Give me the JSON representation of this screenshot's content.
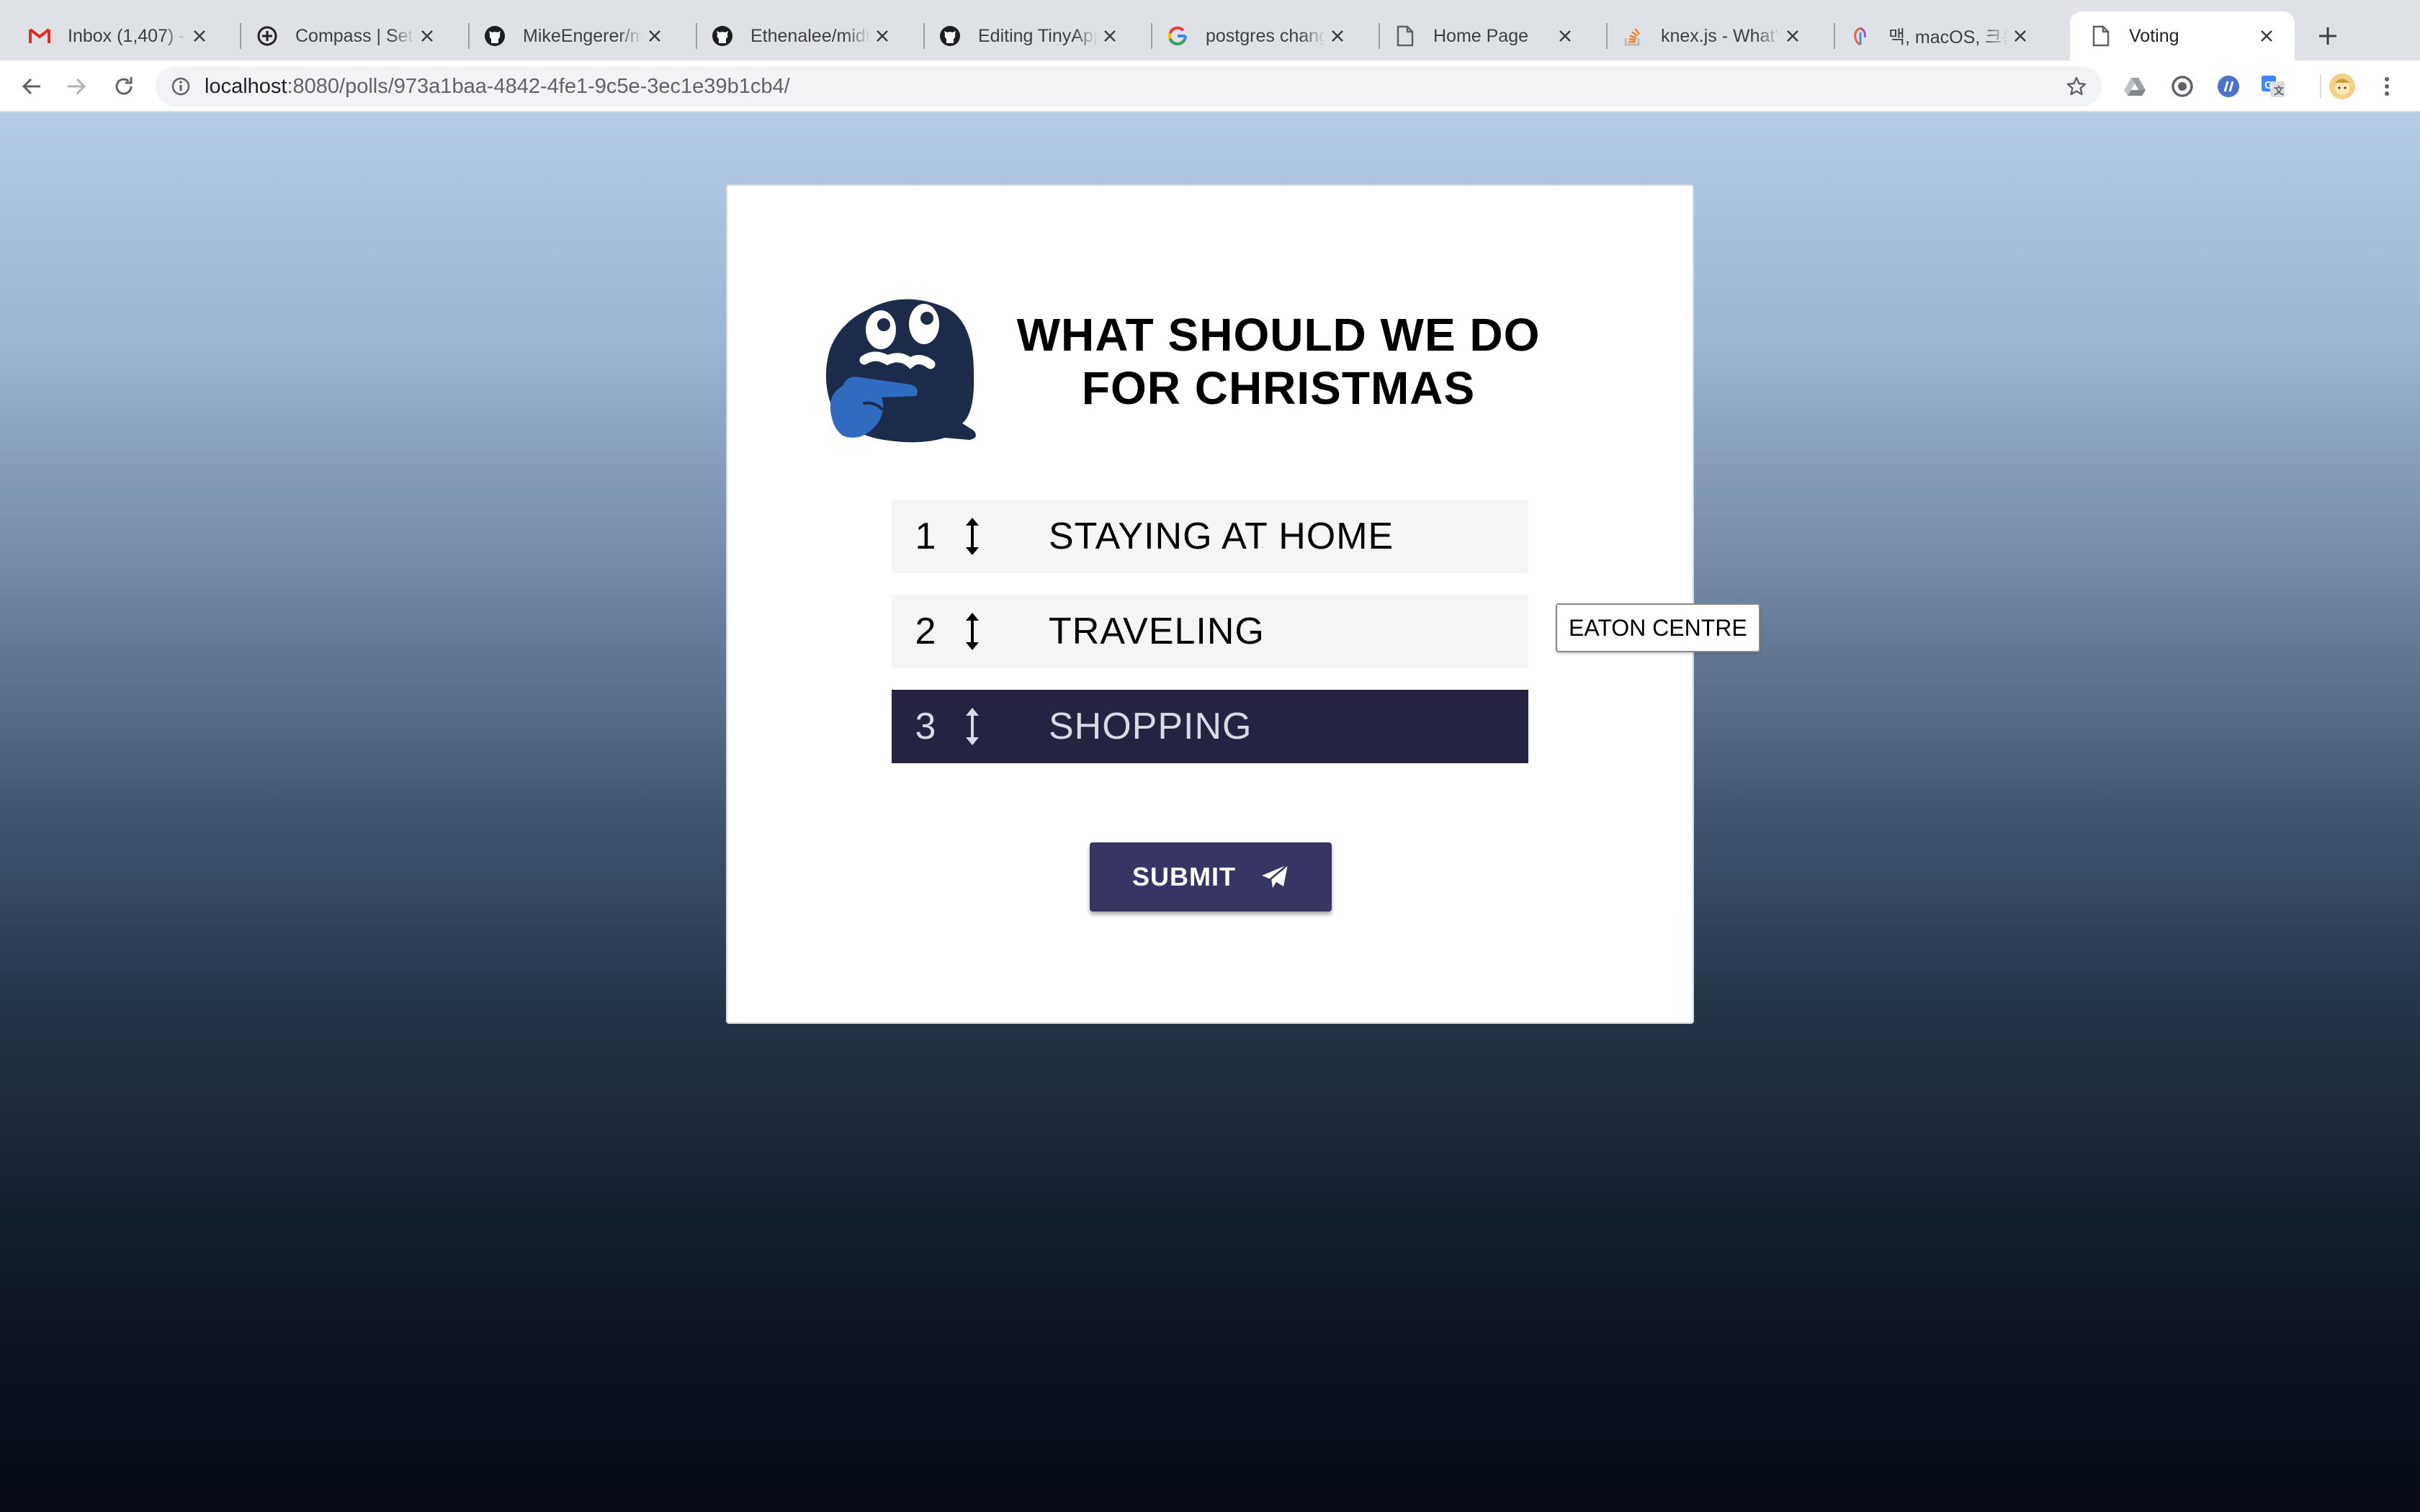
{
  "browser": {
    "tabs": [
      {
        "title": "Inbox (1,407) - y",
        "icon": "gmail-icon",
        "active": false
      },
      {
        "title": "Compass | Setup",
        "icon": "compass-icon",
        "active": false
      },
      {
        "title": "MikeEngerer/mid",
        "icon": "github-icon",
        "active": false
      },
      {
        "title": "Ethenalee/midter",
        "icon": "github-icon",
        "active": false
      },
      {
        "title": "Editing TinyApp/",
        "icon": "github-icon",
        "active": false
      },
      {
        "title": "postgres change",
        "icon": "google-icon",
        "active": false
      },
      {
        "title": "Home Page",
        "icon": "page-icon",
        "active": false
      },
      {
        "title": "knex.js - What's",
        "icon": "stackoverflow-icon",
        "active": false
      },
      {
        "title": "맥, macOS, 크롬(",
        "icon": "site-icon",
        "active": false
      },
      {
        "title": "Voting",
        "icon": "page-icon",
        "active": true
      }
    ],
    "url_host": "localhost",
    "url_path": ":8080/polls/973a1baa-4842-4fe1-9c5e-3ec1e39b1cb4/"
  },
  "poll": {
    "title_line1": "WHAT SHOULD WE DO",
    "title_line2": "FOR CHRISTMAS",
    "options": [
      {
        "rank": "1",
        "label": "STAYING AT HOME"
      },
      {
        "rank": "2",
        "label": "TRAVELING"
      },
      {
        "rank": "3",
        "label": "SHOPPING"
      }
    ],
    "tooltip": "EATON CENTRE",
    "submit_label": "SUBMIT"
  },
  "colors": {
    "selected_option_bg": "#242342",
    "submit_bg": "#363564",
    "mascot_dark": "#1d2b4b",
    "mascot_hand": "#2f6bbf"
  }
}
